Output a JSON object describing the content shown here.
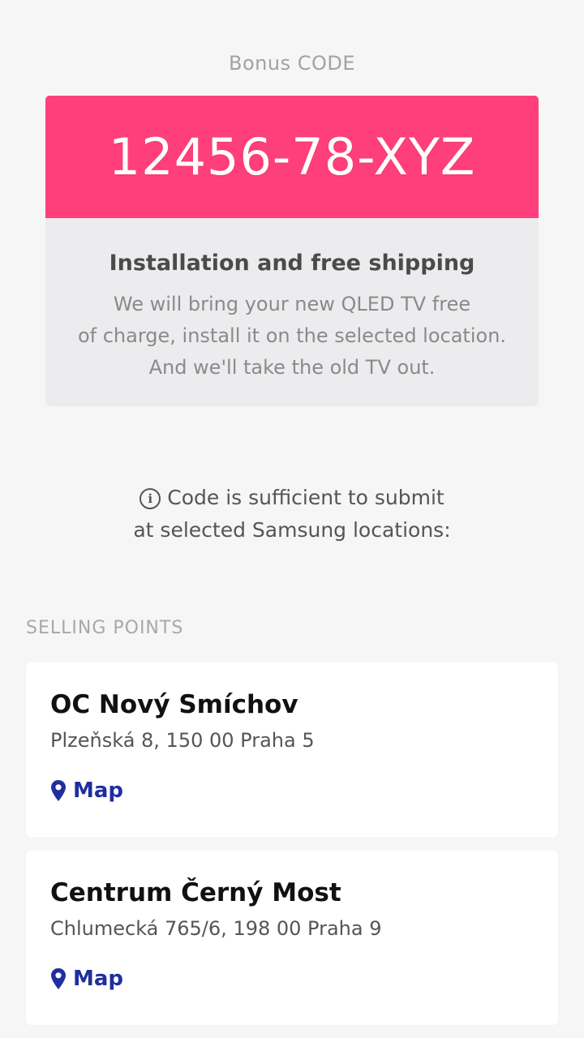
{
  "bonus": {
    "label": "Bonus CODE",
    "code": "12456-78-XYZ",
    "accent_color": "#ff3f7b"
  },
  "offer": {
    "title": "Installation and free shipping",
    "lines": [
      "We will bring your new QLED TV free",
      "of charge, install it on the selected location.",
      "And we'll take the old TV out."
    ]
  },
  "info": {
    "icon": "info-icon",
    "lines": [
      "Code is sufficient to submit",
      "at selected Samsung locations:"
    ]
  },
  "selling_points": {
    "heading": "SELLING POINTS",
    "link_color": "#1f2f9f",
    "items": [
      {
        "name": "OC Nový Smíchov",
        "address": "Plzeňská 8, 150 00 Praha 5",
        "map_label": "Map",
        "map_icon": "map-pin-icon"
      },
      {
        "name": "Centrum Černý Most",
        "address": "Chlumecká 765/6, 198 00 Praha 9",
        "map_label": "Map",
        "map_icon": "map-pin-icon"
      }
    ]
  }
}
